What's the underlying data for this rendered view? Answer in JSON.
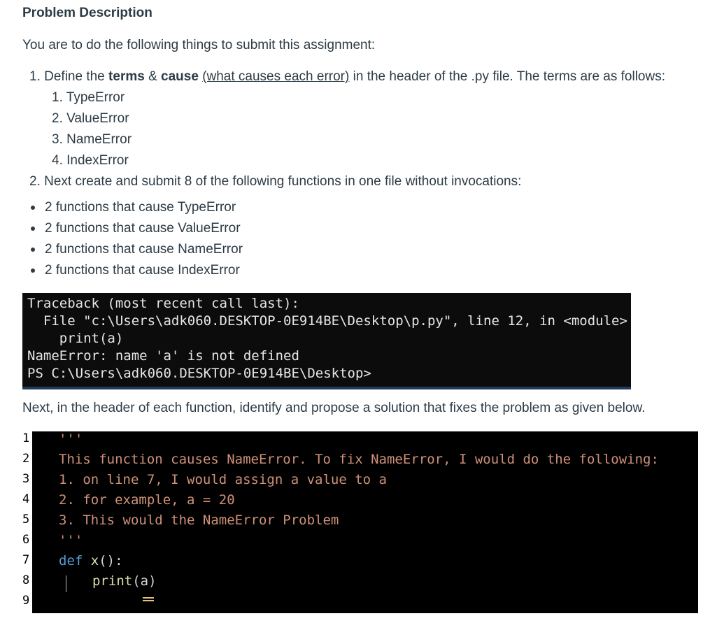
{
  "heading": "Problem Description",
  "intro": "You are to do the following things to submit this assignment:",
  "step1": {
    "number": "1.",
    "prefix": "Define the ",
    "terms": "terms",
    "amp": " & ",
    "cause": "cause",
    "space": " ",
    "link": "(what causes each error)",
    "suffix": " in the header of the .py file. The terms are as follows:"
  },
  "terms_list": [
    "1. TypeError",
    "2. ValueError",
    "3. NameError",
    "4. IndexError"
  ],
  "step2": "2. Next create and submit 8 of the following functions in one file without invocations:",
  "bullets": [
    "2 functions that cause TypeError",
    "2 functions that cause ValueError",
    "2 functions that cause NameError",
    "2 functions that cause IndexError"
  ],
  "terminal": {
    "lines": [
      "Traceback (most recent call last):",
      "  File \"c:\\Users\\adk060.DESKTOP-0E914BE\\Desktop\\p.py\", line 12, in <module>",
      "    print(a)",
      "NameError: name 'a' is not defined",
      "PS C:\\Users\\adk060.DESKTOP-0E914BE\\Desktop>"
    ]
  },
  "next_paragraph": "Next, in the header of each function, identify and propose a solution that fixes the problem as given below.",
  "editor": {
    "line_numbers": [
      "1",
      "2",
      "3",
      "4",
      "5",
      "6",
      "7",
      "8",
      "9"
    ],
    "docstring_open": "'''",
    "doc_lines": [
      "This function causes NameError. To fix NameError, I would do the following:",
      "1. on line 7, I would assign a value to a",
      "2. for example, a = 20",
      "3. This would the NameError Problem"
    ],
    "docstring_close": "'''",
    "def_keyword": "def",
    "func_name": "x",
    "func_sig": "():",
    "print_fn": "print",
    "print_args": "(a)",
    "colors": {
      "docstring": "#ce9178",
      "keyword": "#569cd6",
      "function": "#dcdcaa",
      "plain": "#d4d4d4"
    }
  }
}
